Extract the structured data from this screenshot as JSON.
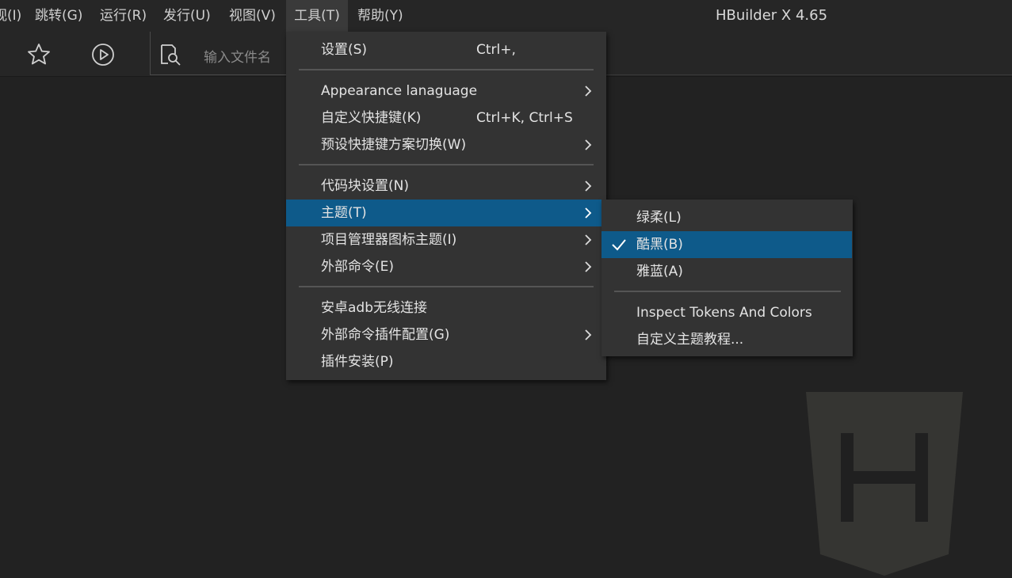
{
  "menubar": {
    "items": [
      "视(I)",
      "跳转(G)",
      "运行(R)",
      "发行(U)",
      "视图(V)",
      "工具(T)",
      "帮助(Y)"
    ],
    "active_index": 5,
    "title": "HBuilder X 4.65"
  },
  "toolbar": {
    "icons": [
      "star-icon",
      "play-icon",
      "file-search-icon"
    ],
    "search_placeholder": "输入文件名"
  },
  "tools_menu": {
    "items": [
      {
        "label": "设置(S)",
        "shortcut": "Ctrl+,",
        "submenu": false
      },
      {
        "label": "Appearance lanaguage",
        "shortcut": "",
        "submenu": true
      },
      {
        "label": "自定义快捷键(K)",
        "shortcut": "Ctrl+K, Ctrl+S",
        "submenu": false
      },
      {
        "label": "预设快捷键方案切换(W)",
        "shortcut": "",
        "submenu": true
      },
      {
        "label": "代码块设置(N)",
        "shortcut": "",
        "submenu": true
      },
      {
        "label": "主题(T)",
        "shortcut": "",
        "submenu": true,
        "highlighted": true
      },
      {
        "label": "项目管理器图标主题(I)",
        "shortcut": "",
        "submenu": true
      },
      {
        "label": "外部命令(E)",
        "shortcut": "",
        "submenu": true
      },
      {
        "label": "安卓adb无线连接",
        "shortcut": "",
        "submenu": false
      },
      {
        "label": "外部命令插件配置(G)",
        "shortcut": "",
        "submenu": true
      },
      {
        "label": "插件安装(P)",
        "shortcut": "",
        "submenu": false
      }
    ]
  },
  "theme_submenu": {
    "items": [
      {
        "label": "绿柔(L)",
        "checked": false
      },
      {
        "label": "酷黑(B)",
        "checked": true,
        "highlighted": true
      },
      {
        "label": "雅蓝(A)",
        "checked": false
      },
      {
        "label": "Inspect Tokens And Colors",
        "checked": false
      },
      {
        "label": "自定义主题教程...",
        "checked": false
      }
    ]
  },
  "colors": {
    "highlight": "#0e5a8a",
    "menu_bg": "#333333",
    "editor_bg": "#222222"
  }
}
